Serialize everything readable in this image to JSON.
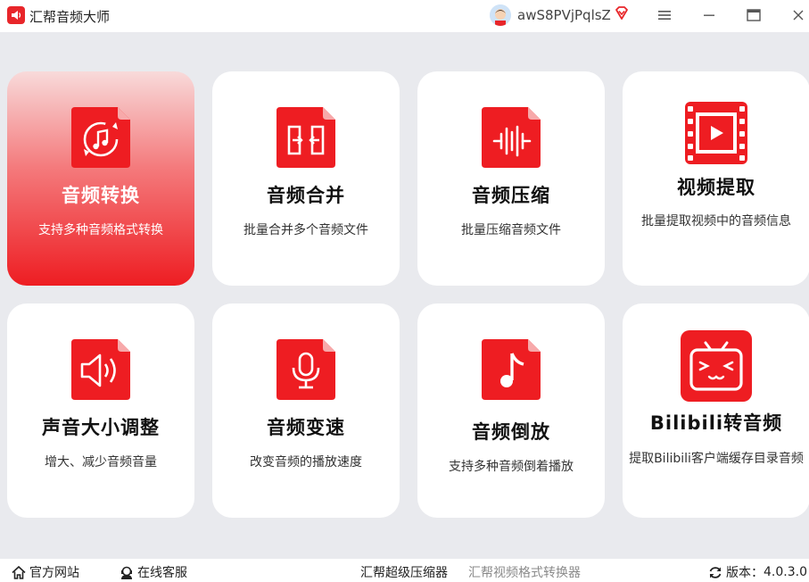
{
  "app": {
    "title": "汇帮音频大师",
    "brand_color": "#e8262a"
  },
  "user": {
    "name": "awS8PVjPqlsZ"
  },
  "cards": [
    {
      "label": "音频转换",
      "desc": "支持多种音频格式转换",
      "icon": "music-convert-icon",
      "active": true
    },
    {
      "label": "音频合并",
      "desc": "批量合并多个音频文件",
      "icon": "merge-icon",
      "active": false
    },
    {
      "label": "音频压缩",
      "desc": "批量压缩音频文件",
      "icon": "waveform-compress-icon",
      "active": false
    },
    {
      "label": "视频提取",
      "desc": "批量提取视频中的音频信息",
      "icon": "film-play-icon",
      "active": false
    },
    {
      "label": "声音大小调整",
      "desc": "增大、减少音频音量",
      "icon": "speaker-volume-icon",
      "active": false
    },
    {
      "label": "音频变速",
      "desc": "改变音频的播放速度",
      "icon": "microphone-icon",
      "active": false
    },
    {
      "label": "音频倒放",
      "desc": "支持多种音频倒着播放",
      "icon": "music-note-icon",
      "active": false
    },
    {
      "label": "Bilibili转音频",
      "desc": "提取Bilibili客户端缓存目录音频",
      "icon": "bilibili-tv-icon",
      "active": false
    }
  ],
  "footer": {
    "website": "官方网站",
    "support": "在线客服",
    "link1": "汇帮超级压缩器",
    "link2": "汇帮视频格式转换器",
    "version_label": "版本：",
    "version": "4.0.3.0"
  }
}
